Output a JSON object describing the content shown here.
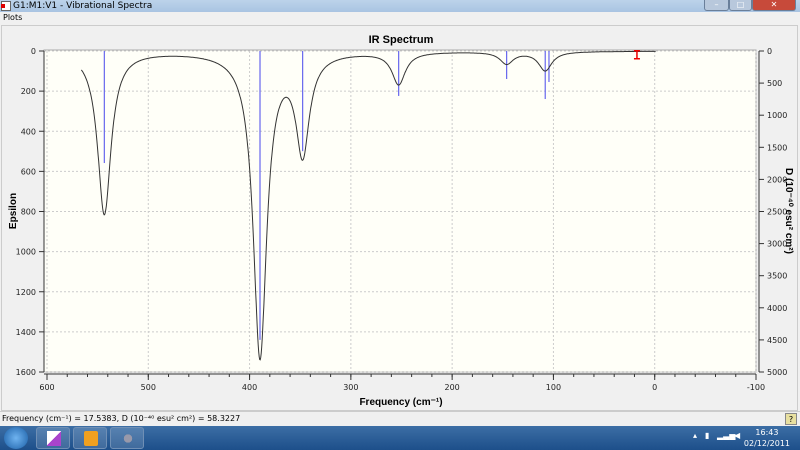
{
  "window": {
    "title": "G1:M1:V1 - Vibrational Spectra",
    "menu": [
      "Plots"
    ]
  },
  "status": {
    "readout": "Frequency (cm⁻¹) = 17.5383, D (10⁻⁴⁰ esu² cm²) = 58.3227",
    "help_icon": "help-icon"
  },
  "taskbar": {
    "time": "16:43",
    "date": "02/12/2011",
    "apps": [
      "document-app",
      "outlook-app",
      "gaussview-app"
    ]
  },
  "chart_data": {
    "type": "line",
    "title": "IR Spectrum",
    "xlabel": "Frequency (cm⁻¹)",
    "ylabel": "Epsilon",
    "y2label": "D (10⁻⁴⁰ esu² cm²)",
    "xlim": [
      600,
      -100
    ],
    "ylim": [
      0,
      1600
    ],
    "y_inverted": true,
    "y2lim": [
      0,
      5000
    ],
    "xticks": [
      "600",
      "500",
      "400",
      "300",
      "200",
      "100",
      "0",
      "-100"
    ],
    "yticks": [
      "0",
      "200",
      "400",
      "600",
      "800",
      "1000",
      "1200",
      "1400",
      "1600"
    ],
    "y2ticks": [
      "0",
      "500",
      "1000",
      "1500",
      "2000",
      "2500",
      "3000",
      "3500",
      "4000",
      "4500",
      "5000"
    ],
    "grid": true,
    "background": "#fffff8",
    "line_color": "#333333",
    "stick_color": "#6666ee",
    "marker_color": "#ee0000",
    "peaks": [
      {
        "freq": 543.4,
        "epsilon": 812,
        "D": 1745
      },
      {
        "freq": 389.7,
        "epsilon": 1520,
        "D": 4500
      },
      {
        "freq": 347.6,
        "epsilon": 489,
        "D": 1560
      },
      {
        "freq": 252.8,
        "epsilon": 160,
        "D": 700
      },
      {
        "freq": 146.2,
        "epsilon": 60,
        "D": 436
      },
      {
        "freq": 108.1,
        "epsilon": 95,
        "D": 748
      },
      {
        "freq": 104.4,
        "epsilon": 0,
        "D": 483
      }
    ],
    "curve_range": [
      566,
      -1
    ],
    "marker": {
      "freq": 17.5383,
      "D": 58.3227
    }
  }
}
